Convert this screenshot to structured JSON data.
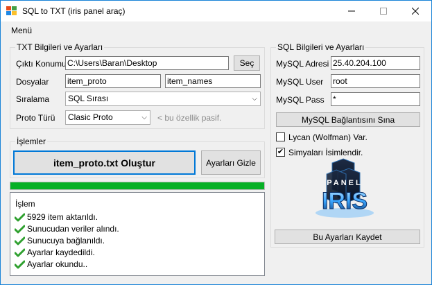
{
  "window": {
    "title": "SQL to TXT (iris panel araç)"
  },
  "menu": {
    "items": [
      "Menü"
    ]
  },
  "txt_group": {
    "title": "TXT Bilgileri ve Ayarları",
    "output_label": "Çıktı Konumu",
    "output_value": "C:\\Users\\Baran\\Desktop",
    "browse_label": "Seç",
    "files_label": "Dosyalar",
    "file1_value": "item_proto",
    "file2_value": "item_names",
    "order_label": "Sıralama",
    "order_value": "SQL Sırası",
    "proto_label": "Proto Türü",
    "proto_value": "Clasic Proto",
    "proto_hint": "< bu özellik pasif."
  },
  "ops_group": {
    "title": "İşlemler",
    "create_label": "item_proto.txt Oluştur",
    "hide_label": "Ayarları Gizle"
  },
  "progress": {
    "value": 100
  },
  "log": {
    "title": "İşlem",
    "lines": [
      "5929 item aktarıldı.",
      "Sunucudan veriler alındı.",
      "Sunucuya bağlanıldı.",
      "Ayarlar kaydedildi.",
      "Ayarlar okundu.."
    ]
  },
  "sql_group": {
    "title": "SQL Bilgileri ve Ayarları",
    "address_label": "MySQL Adresi",
    "address_value": "25.40.204.100",
    "user_label": "MySQL User",
    "user_value": "root",
    "pass_label": "MySQL Pass",
    "pass_value": "*",
    "test_label": "MySQL Bağlantısını Sına",
    "lycan_label": "Lycan (Wolfman) Var.",
    "lycan_checked": false,
    "names_label": "Simyaları İsimlendir.",
    "names_checked": true,
    "save_label": "Bu Ayarları Kaydet"
  },
  "logo": {
    "top_text": "PANEL",
    "main_text": "IRIS"
  },
  "colors": {
    "progress": "#06b025",
    "accent": "#0078d7",
    "check": "#2fa02f",
    "logo": "#3aa6ff"
  }
}
